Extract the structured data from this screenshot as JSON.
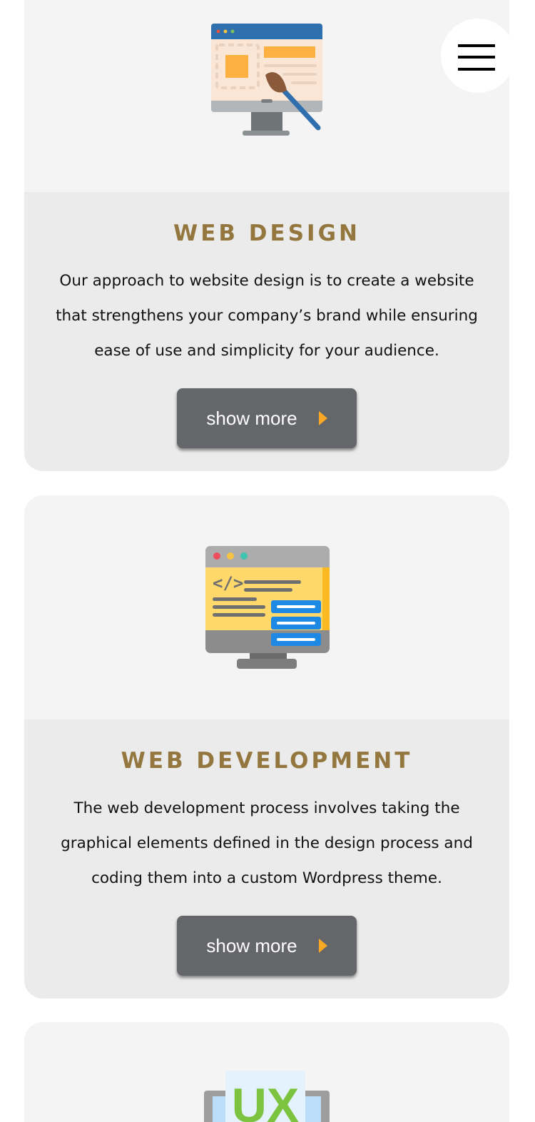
{
  "menu": {
    "icon": "hamburger-menu-icon"
  },
  "cards": [
    {
      "icon": "web-design-monitor-icon",
      "title": "WEB DESIGN",
      "description": "Our approach to website design is to create a website that strengthens your company’s brand while ensuring ease of use and simplicity for your audience.",
      "button_label": "show more"
    },
    {
      "icon": "web-development-code-monitor-icon",
      "title": "WEB DEVELOPMENT",
      "description": "The web development process involves taking the graphical elements defined in the design process and coding them into a custom Wordpress theme.",
      "button_label": "show more"
    },
    {
      "icon": "ux-design-icon",
      "icon_text": "UX"
    }
  ],
  "colors": {
    "title": "#94773f",
    "button": "#646669",
    "button_arrow": "#f9a825",
    "card_top": "#f4f4f4",
    "card_bottom": "#ebebeb"
  }
}
